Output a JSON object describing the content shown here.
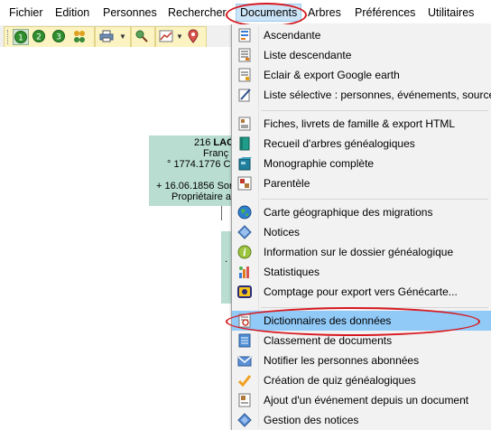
{
  "menubar": {
    "items": [
      {
        "label": "Fichier"
      },
      {
        "label": "Edition"
      },
      {
        "label": "Personnes"
      },
      {
        "label": "Rechercher"
      },
      {
        "label": "Documents"
      },
      {
        "label": "Arbres"
      },
      {
        "label": "Préférences"
      },
      {
        "label": "Utilitaires"
      }
    ],
    "active": "Documents"
  },
  "toolbar": {
    "buttons": [
      "generation-1-icon",
      "generation-2-icon",
      "generation-3-icon",
      "family-icon",
      "printer-icon",
      "person-search-icon",
      "chart-icon",
      "map-pin-icon"
    ]
  },
  "tree": {
    "top_box": {
      "line1_number": "216",
      "line1_name": "LAC",
      "line2": "Franç",
      "line3": "° 1774.1776 C",
      "line4": "+ 16.06.1856 Sor",
      "line5": "Propriétaire a"
    },
    "bottom_box": {
      "line1": "."
    }
  },
  "documents_menu": {
    "items": [
      {
        "label": "Ascendante",
        "icon": "ascendant-tree-icon"
      },
      {
        "label": "Liste descendante",
        "icon": "descendant-list-icon"
      },
      {
        "label": "Eclair & export Google earth",
        "icon": "google-earth-export-icon"
      },
      {
        "label": "Liste sélective : personnes, événements, sources",
        "icon": "selective-list-icon"
      },
      {
        "label": "Fiches, livrets de famille & export HTML",
        "icon": "family-booklet-icon"
      },
      {
        "label": "Recueil d'arbres généalogiques",
        "icon": "tree-collection-icon"
      },
      {
        "label": "Monographie complète",
        "icon": "monograph-icon"
      },
      {
        "label": "Parentèle",
        "icon": "kinship-icon"
      },
      {
        "label": "Carte géographique des migrations",
        "icon": "globe-icon"
      },
      {
        "label": "Notices",
        "icon": "notices-icon"
      },
      {
        "label": "Information sur le dossier généalogique",
        "icon": "info-icon"
      },
      {
        "label": "Statistiques",
        "icon": "statistics-icon"
      },
      {
        "label": "Comptage pour export vers Génécarte...",
        "icon": "genecarte-count-icon"
      },
      {
        "label": "Dictionnaires des données",
        "icon": "data-dictionary-icon"
      },
      {
        "label": "Classement de documents",
        "icon": "document-filing-icon"
      },
      {
        "label": "Notifier les personnes abonnées",
        "icon": "notify-icon"
      },
      {
        "label": "Création de quiz généalogiques",
        "icon": "quiz-checkmark-icon"
      },
      {
        "label": "Ajout d'un événement depuis un document",
        "icon": "add-event-icon"
      },
      {
        "label": "Gestion des notices",
        "icon": "notices-management-icon"
      }
    ],
    "highlighted": "Dictionnaires des données"
  },
  "colors": {
    "highlight": "#91c9f7",
    "annotation_ring": "#d7191f",
    "tree_box": "#b9ddd0",
    "toolbar_group": "#fbf3c2"
  }
}
